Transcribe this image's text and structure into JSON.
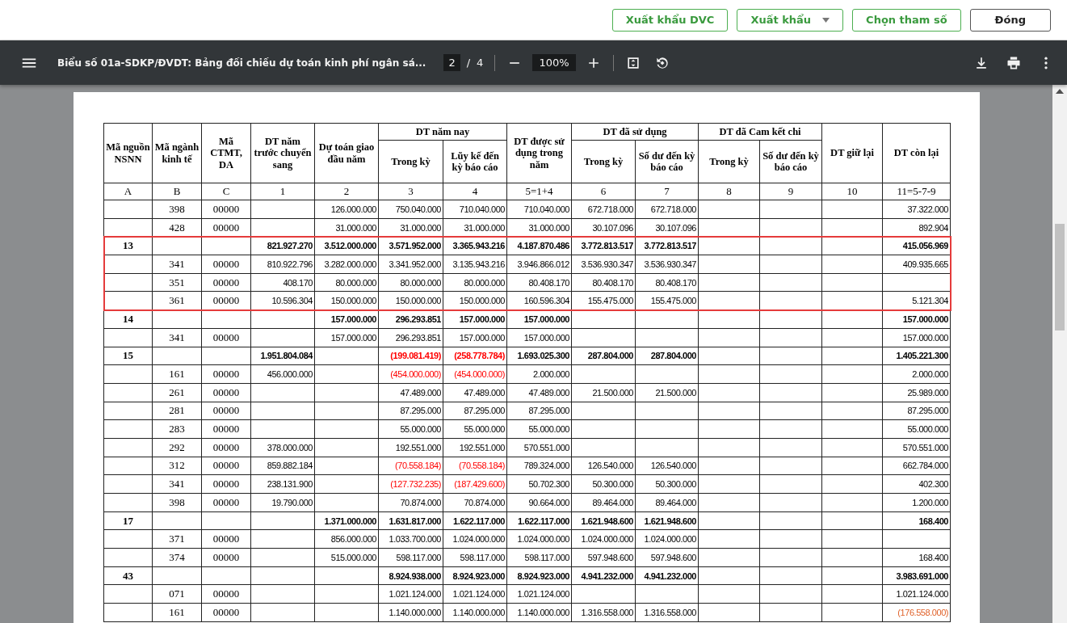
{
  "top_bar": {
    "buttons": [
      {
        "label": "Xuất khẩu DVC",
        "kind": "plain"
      },
      {
        "label": "Xuất khẩu",
        "kind": "dropdown"
      },
      {
        "label": "Chọn tham số",
        "kind": "plain"
      },
      {
        "label": "Đóng",
        "kind": "neutral"
      }
    ]
  },
  "viewer_toolbar": {
    "title": "Biểu số 01a-SDKP/ĐVDT: Bảng đối chiếu dự toán kinh phí ngân sá...",
    "page": "2",
    "separator": "/",
    "page_count": "4",
    "zoom": "100%"
  },
  "table": {
    "columns": [
      {
        "label": "Mã nguồn NSNN"
      },
      {
        "label": "Mã ngành kinh tế"
      },
      {
        "label": "Mã CTMT, DA"
      },
      {
        "label": "DT năm trước chuyển sang"
      },
      {
        "label": "Dự toán giao đầu năm"
      },
      {
        "label": "DT năm nay",
        "colspan": 2,
        "children": [
          {
            "label": "Trong kỳ"
          },
          {
            "label": "Lũy kế đến kỳ báo cáo"
          }
        ]
      },
      {
        "label": "DT được sử dụng trong năm"
      },
      {
        "label": "DT đã sử dụng",
        "colspan": 2,
        "children": [
          {
            "label": "Trong kỳ"
          },
          {
            "label": "Số dư đến kỳ báo cáo"
          }
        ]
      },
      {
        "label": "DT đã Cam kết chi",
        "colspan": 2,
        "children": [
          {
            "label": "Trong kỳ"
          },
          {
            "label": "Số dư đến kỳ báo cáo"
          }
        ]
      },
      {
        "label": "DT giữ lại"
      },
      {
        "label": "DT còn lại"
      }
    ],
    "column_numbers": [
      "A",
      "B",
      "C",
      "1",
      "2",
      "3",
      "4",
      "5=1+4",
      "6",
      "7",
      "8",
      "9",
      "10",
      "11=5-7-9"
    ],
    "rows": [
      {
        "kind": "item",
        "highlighted": false,
        "cells": [
          "",
          "398",
          "00000",
          "",
          "126.000.000",
          "750.040.000",
          "710.040.000",
          "710.040.000",
          "672.718.000",
          "672.718.000",
          "",
          "",
          "",
          "37.322.000"
        ]
      },
      {
        "kind": "item",
        "highlighted": false,
        "cells": [
          "",
          "428",
          "00000",
          "",
          "31.000.000",
          "31.000.000",
          "31.000.000",
          "31.000.000",
          "30.107.096",
          "30.107.096",
          "",
          "",
          "",
          "892.904"
        ]
      },
      {
        "kind": "group",
        "highlighted": true,
        "cells": [
          "13",
          "",
          "",
          "821.927.270",
          "3.512.000.000",
          "3.571.952.000",
          "3.365.943.216",
          "4.187.870.486",
          "3.772.813.517",
          "3.772.813.517",
          "",
          "",
          "",
          "415.056.969"
        ]
      },
      {
        "kind": "item",
        "highlighted": true,
        "cells": [
          "",
          "341",
          "00000",
          "810.922.796",
          "3.282.000.000",
          "3.341.952.000",
          "3.135.943.216",
          "3.946.866.012",
          "3.536.930.347",
          "3.536.930.347",
          "",
          "",
          "",
          "409.935.665"
        ]
      },
      {
        "kind": "item",
        "highlighted": true,
        "cells": [
          "",
          "351",
          "00000",
          "408.170",
          "80.000.000",
          "80.000.000",
          "80.000.000",
          "80.408.170",
          "80.408.170",
          "80.408.170",
          "",
          "",
          "",
          ""
        ]
      },
      {
        "kind": "item",
        "highlighted": true,
        "cells": [
          "",
          "361",
          "00000",
          "10.596.304",
          "150.000.000",
          "150.000.000",
          "150.000.000",
          "160.596.304",
          "155.475.000",
          "155.475.000",
          "",
          "",
          "",
          "5.121.304"
        ]
      },
      {
        "kind": "group",
        "highlighted": false,
        "cells": [
          "14",
          "",
          "",
          "",
          "157.000.000",
          "296.293.851",
          "157.000.000",
          "157.000.000",
          "",
          "",
          "",
          "",
          "",
          "157.000.000"
        ]
      },
      {
        "kind": "item",
        "highlighted": false,
        "cells": [
          "",
          "341",
          "00000",
          "",
          "157.000.000",
          "296.293.851",
          "157.000.000",
          "157.000.000",
          "",
          "",
          "",
          "",
          "",
          "157.000.000"
        ]
      },
      {
        "kind": "group",
        "highlighted": false,
        "cells": [
          "15",
          "",
          "",
          "1.951.804.084",
          "",
          {
            "text": "(199.081.419)",
            "color": "#ff0000"
          },
          {
            "text": "(258.778.784)",
            "color": "#ff0000"
          },
          "1.693.025.300",
          "287.804.000",
          "287.804.000",
          "",
          "",
          "",
          "1.405.221.300"
        ]
      },
      {
        "kind": "item",
        "highlighted": false,
        "cells": [
          "",
          "161",
          "00000",
          "456.000.000",
          "",
          {
            "text": "(454.000.000)",
            "color": "#ff0000"
          },
          {
            "text": "(454.000.000)",
            "color": "#ff0000"
          },
          "2.000.000",
          "",
          "",
          "",
          "",
          "",
          "2.000.000"
        ]
      },
      {
        "kind": "item",
        "highlighted": false,
        "cells": [
          "",
          "261",
          "00000",
          "",
          "",
          "47.489.000",
          "47.489.000",
          "47.489.000",
          "21.500.000",
          "21.500.000",
          "",
          "",
          "",
          "25.989.000"
        ]
      },
      {
        "kind": "item",
        "highlighted": false,
        "cells": [
          "",
          "281",
          "00000",
          "",
          "",
          "87.295.000",
          "87.295.000",
          "87.295.000",
          "",
          "",
          "",
          "",
          "",
          "87.295.000"
        ]
      },
      {
        "kind": "item",
        "highlighted": false,
        "cells": [
          "",
          "283",
          "00000",
          "",
          "",
          "55.000.000",
          "55.000.000",
          "55.000.000",
          "",
          "",
          "",
          "",
          "",
          "55.000.000"
        ]
      },
      {
        "kind": "item",
        "highlighted": false,
        "cells": [
          "",
          "292",
          "00000",
          "378.000.000",
          "",
          "192.551.000",
          "192.551.000",
          "570.551.000",
          "",
          "",
          "",
          "",
          "",
          "570.551.000"
        ]
      },
      {
        "kind": "item",
        "highlighted": false,
        "cells": [
          "",
          "312",
          "00000",
          "859.882.184",
          "",
          {
            "text": "(70.558.184)",
            "color": "#ff0000"
          },
          {
            "text": "(70.558.184)",
            "color": "#ff0000"
          },
          "789.324.000",
          "126.540.000",
          "126.540.000",
          "",
          "",
          "",
          "662.784.000"
        ]
      },
      {
        "kind": "item",
        "highlighted": false,
        "cells": [
          "",
          "341",
          "00000",
          "238.131.900",
          "",
          {
            "text": "(127.732.235)",
            "color": "#ff0000"
          },
          {
            "text": "(187.429.600)",
            "color": "#ff0000"
          },
          "50.702.300",
          "50.300.000",
          "50.300.000",
          "",
          "",
          "",
          "402.300"
        ]
      },
      {
        "kind": "item",
        "highlighted": false,
        "cells": [
          "",
          "398",
          "00000",
          "19.790.000",
          "",
          "70.874.000",
          "70.874.000",
          "90.664.000",
          "89.464.000",
          "89.464.000",
          "",
          "",
          "",
          "1.200.000"
        ]
      },
      {
        "kind": "group",
        "highlighted": false,
        "cells": [
          "17",
          "",
          "",
          "",
          "1.371.000.000",
          "1.631.817.000",
          "1.622.117.000",
          "1.622.117.000",
          "1.621.948.600",
          "1.621.948.600",
          "",
          "",
          "",
          "168.400"
        ]
      },
      {
        "kind": "item",
        "highlighted": false,
        "cells": [
          "",
          "371",
          "00000",
          "",
          "856.000.000",
          "1.033.700.000",
          "1.024.000.000",
          "1.024.000.000",
          "1.024.000.000",
          "1.024.000.000",
          "",
          "",
          "",
          ""
        ]
      },
      {
        "kind": "item",
        "highlighted": false,
        "cells": [
          "",
          "374",
          "00000",
          "",
          "515.000.000",
          "598.117.000",
          "598.117.000",
          "598.117.000",
          "597.948.600",
          "597.948.600",
          "",
          "",
          "",
          "168.400"
        ]
      },
      {
        "kind": "group",
        "highlighted": false,
        "cells": [
          "43",
          "",
          "",
          "",
          "",
          "8.924.938.000",
          "8.924.923.000",
          "8.924.923.000",
          "4.941.232.000",
          "4.941.232.000",
          "",
          "",
          "",
          "3.983.691.000"
        ]
      },
      {
        "kind": "item",
        "highlighted": false,
        "cells": [
          "",
          "071",
          "00000",
          "",
          "",
          "1.021.124.000",
          "1.021.124.000",
          "1.021.124.000",
          "",
          "",
          "",
          "",
          "",
          "1.021.124.000"
        ]
      },
      {
        "kind": "item",
        "highlighted": false,
        "cells": [
          "",
          "161",
          "00000",
          "",
          "",
          "1.140.000.000",
          "1.140.000.000",
          "1.140.000.000",
          "1.316.558.000",
          "1.316.558.000",
          "",
          "",
          "",
          {
            "text": "(176.558.000)",
            "color": "#e0622a"
          }
        ]
      }
    ]
  }
}
